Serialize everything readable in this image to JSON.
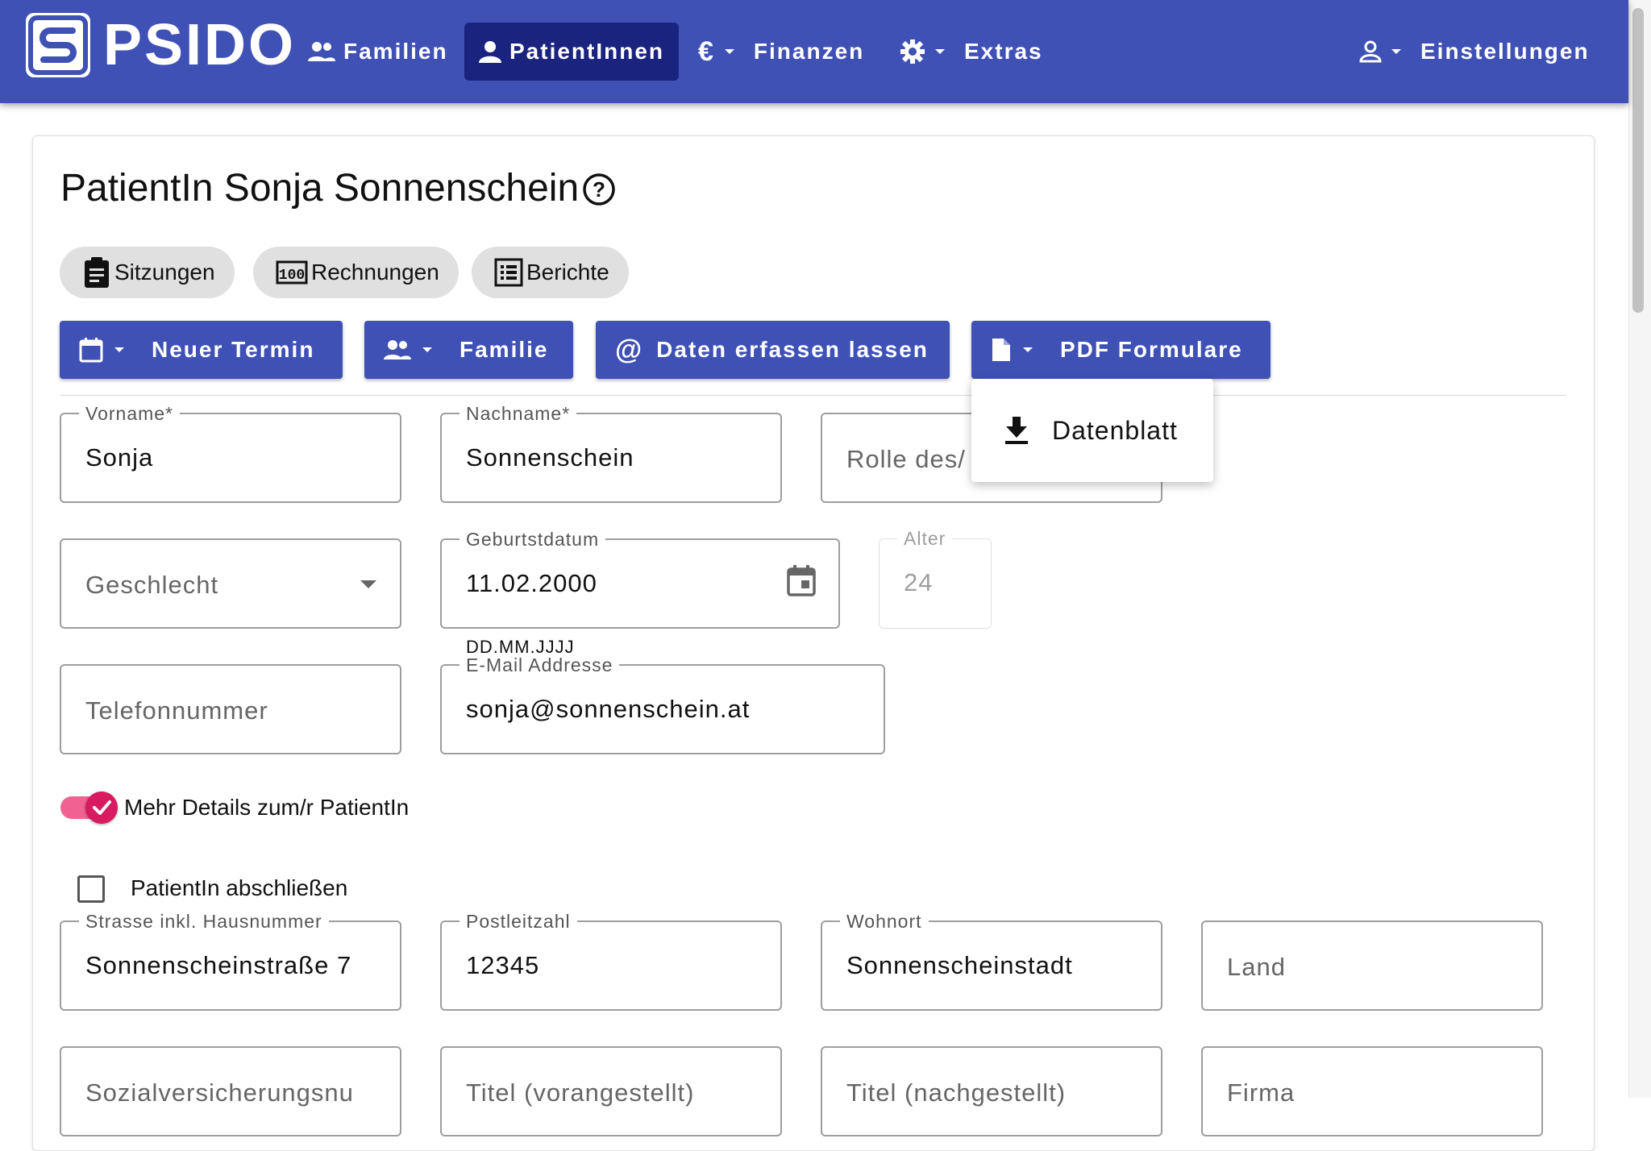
{
  "app": {
    "brand": "PSIDO",
    "nav": {
      "familien": "Familien",
      "patienten": "PatientInnen",
      "finanzen": "Finanzen",
      "extras": "Extras",
      "einstellungen": "Einstellungen"
    },
    "colors": {
      "primary": "#3f51b5",
      "active_nav": "#1a237e",
      "accent": "#d81b60"
    }
  },
  "page": {
    "title": "PatientIn Sonja Sonnenschein",
    "chips": {
      "sitzungen": "Sitzungen",
      "rechnungen": "Rechnungen",
      "berichte": "Berichte"
    },
    "actions": {
      "neuer_termin": "Neuer Termin",
      "familie": "Familie",
      "daten_erfassen": "Daten erfassen lassen",
      "pdf_formulare": "PDF Formulare"
    },
    "pdf_menu": {
      "datenblatt": "Datenblatt"
    }
  },
  "form": {
    "vorname": {
      "label": "Vorname*",
      "value": "Sonja"
    },
    "nachname": {
      "label": "Nachname*",
      "value": "Sonnenschein"
    },
    "rolle": {
      "placeholder": "Rolle des/"
    },
    "geschlecht": {
      "placeholder": "Geschlecht"
    },
    "geburtsdatum": {
      "label": "Geburtstdatum",
      "value": "11.02.2000",
      "hint": "DD.MM.JJJJ"
    },
    "alter": {
      "label": "Alter",
      "value": "24"
    },
    "telefon": {
      "placeholder": "Telefonnummer"
    },
    "email": {
      "label": "E-Mail Addresse",
      "value": "sonja@sonnenschein.at"
    },
    "mehr_details": {
      "label": "Mehr Details zum/r PatientIn",
      "checked": true
    },
    "abschliessen": {
      "label": "PatientIn abschließen",
      "checked": false
    },
    "strasse": {
      "label": "Strasse inkl. Hausnummer",
      "value": "Sonnenscheinstraße 7"
    },
    "plz": {
      "label": "Postleitzahl",
      "value": "12345"
    },
    "wohnort": {
      "label": "Wohnort",
      "value": "Sonnenscheinstadt"
    },
    "land": {
      "placeholder": "Land"
    },
    "svnr": {
      "placeholder": "Sozialversicherungsnu"
    },
    "titel_vor": {
      "placeholder": "Titel (vorangestellt)"
    },
    "titel_nach": {
      "placeholder": "Titel (nachgestellt)"
    },
    "firma": {
      "placeholder": "Firma"
    }
  },
  "icons": {
    "logo": "psido-logo-icon",
    "familien": "people-icon",
    "patienten": "person-icon",
    "finanzen": "euro-icon",
    "extras": "gear-icon",
    "einstellungen": "user-outline-icon",
    "help": "help-circle-icon",
    "sitzungen": "clipboard-icon",
    "rechnungen": "counter-icon",
    "berichte": "list-icon",
    "calendar": "calendar-icon",
    "email": "at-icon",
    "pdf": "file-icon",
    "download": "download-icon",
    "dropdown": "caret-down-icon"
  }
}
